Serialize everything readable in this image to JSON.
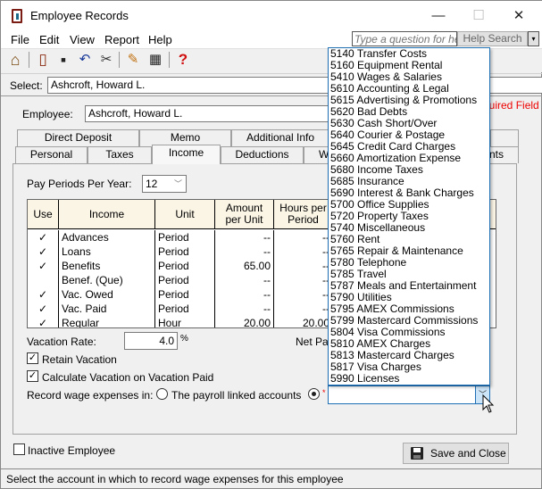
{
  "window": {
    "title": "Employee Records",
    "controls": {
      "minimize": "—",
      "maximize": "☐",
      "close": "✕"
    }
  },
  "menu": [
    "File",
    "Edit",
    "View",
    "Report",
    "Help"
  ],
  "help": {
    "placeholder": "Type a question for help",
    "search_label": "Help Search",
    "dropdown": "▾"
  },
  "toolbar": {
    "icons": [
      "home-icon",
      "open-book-icon",
      "save-icon",
      "undo-icon",
      "eraser-icon",
      "pencil-icon",
      "calculator-icon",
      "help-icon"
    ],
    "glyphs": {
      "home": "⌂",
      "book": "▯",
      "save": "▪",
      "undo": "↶",
      "eraser": "✂",
      "pencil": "✎",
      "calc": "▦",
      "help": "?"
    }
  },
  "select": {
    "label": "Select:",
    "value": "Ashcroft, Howard L."
  },
  "employee": {
    "label": "Employee:",
    "value": "Ashcroft, Howard L.",
    "required_text": "quired Field"
  },
  "tabs": {
    "back_row": [
      "Direct Deposit",
      "Memo",
      "Additional Info",
      ""
    ],
    "front_row": [
      "Personal",
      "Taxes",
      "Income",
      "Deductions",
      "W",
      "nts"
    ],
    "active": "Income"
  },
  "pay_periods": {
    "label": "Pay Periods Per Year:",
    "value": "12"
  },
  "income_grid": {
    "headers": [
      "Use",
      "Income",
      "Unit",
      "Amount per Unit",
      "Hours per Period"
    ],
    "rows": [
      {
        "use": "✓",
        "income": "Advances",
        "unit": "Period",
        "amount": "--",
        "hours": "--"
      },
      {
        "use": "✓",
        "income": "Loans",
        "unit": "Period",
        "amount": "--",
        "hours": "--"
      },
      {
        "use": "✓",
        "income": "Benefits",
        "unit": "Period",
        "amount": "65.00",
        "hours": "--"
      },
      {
        "use": "",
        "income": "Benef. (Que)",
        "unit": "Period",
        "amount": "--",
        "hours": "--"
      },
      {
        "use": "✓",
        "income": "Vac. Owed",
        "unit": "Period",
        "amount": "--",
        "hours": "--"
      },
      {
        "use": "✓",
        "income": "Vac. Paid",
        "unit": "Period",
        "amount": "--",
        "hours": "--"
      },
      {
        "use": "✓",
        "income": "Regular",
        "unit": "Hour",
        "amount": "20.00",
        "hours": "20.00"
      }
    ]
  },
  "vacation": {
    "rate_label": "Vacation Rate:",
    "rate_value": "4.0",
    "percent": "%",
    "net_pay_label": "Net Pay"
  },
  "checkboxes": {
    "retain_vacation": {
      "label": "Retain Vacation",
      "checked": true
    },
    "calc_vacation": {
      "label": "Calculate Vacation on Vacation Paid",
      "checked": true
    },
    "inactive": {
      "label": "Inactive Employee",
      "checked": false
    }
  },
  "record_wage": {
    "label": "Record wage expenses in:",
    "option1": "The payroll linked accounts",
    "selected": "option2",
    "required_mark": "*",
    "combo_value": ""
  },
  "account_dropdown": [
    "5140 Transfer Costs",
    "5160 Equipment Rental",
    "5410 Wages & Salaries",
    "5610 Accounting & Legal",
    "5615 Advertising & Promotions",
    "5620 Bad Debts",
    "5630 Cash Short/Over",
    "5640 Courier & Postage",
    "5645 Credit Card Charges",
    "5660 Amortization Expense",
    "5680 Income Taxes",
    "5685 Insurance",
    "5690 Interest & Bank Charges",
    "5700 Office Supplies",
    "5720 Property Taxes",
    "5740 Miscellaneous",
    "5760 Rent",
    "5765 Repair & Maintenance",
    "5780 Telephone",
    "5785 Travel",
    "5787 Meals and Entertainment",
    "5790 Utilities",
    "5795 AMEX Commissions",
    "5799 Mastercard Commissions",
    "5804 Visa Commissions",
    "5810 AMEX Charges",
    "5813 Mastercard Charges",
    "5817 Visa Charges",
    "5990 Licenses"
  ],
  "save_button": {
    "label": "Save and Close"
  },
  "status_bar": "Select the account in which to record wage expenses for this employee",
  "colors": {
    "required": "#e00000",
    "grid_header": "#fbf5e6",
    "focus_border": "#1e6fb3"
  }
}
